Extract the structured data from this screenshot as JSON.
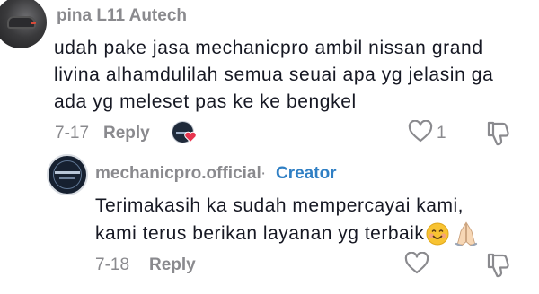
{
  "comment": {
    "username": "pina L11 Autech",
    "text_line1": "udah pake jasa mechanicpro ambil nissan grand",
    "text_line2": "livina alhamdulilah semua seuai apa yg jelasin ga",
    "text_line3": "ada yg meleset pas ke ke bengkel",
    "date": "7-17",
    "reply_label": "Reply",
    "like_count": "1"
  },
  "reply": {
    "username": "mechanicpro.official",
    "separator": "·",
    "creator_badge": "Creator",
    "text_line1": "Terimakasih ka sudah mempercayai kami,",
    "text_line2": "kami terus berikan layanan yg terbaik",
    "emoji_icons": [
      "smiling-face-icon",
      "folded-hands-icon"
    ],
    "date": "7-18",
    "reply_label": "Reply"
  },
  "colors": {
    "muted": "#8a8a8e",
    "text": "#161823",
    "creator": "#2f7fc4",
    "heart": "#e8344e"
  }
}
